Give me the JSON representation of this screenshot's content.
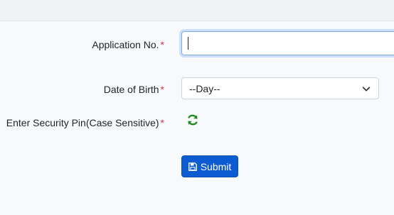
{
  "form": {
    "application_no": {
      "label": "Application No.",
      "required_mark": "*",
      "value": ""
    },
    "dob": {
      "label": "Date of Birth",
      "required_mark": "*",
      "selected": "--Day--"
    },
    "security_pin": {
      "label": "Enter Security Pin(Case Sensitive)",
      "required_mark": "*",
      "refresh_icon": "refresh-icon"
    },
    "submit": {
      "label": "Submit",
      "icon": "save-icon"
    }
  },
  "colors": {
    "primary": "#0d5bd1",
    "required": "#dc3545",
    "refresh": "#1f8a1f"
  }
}
